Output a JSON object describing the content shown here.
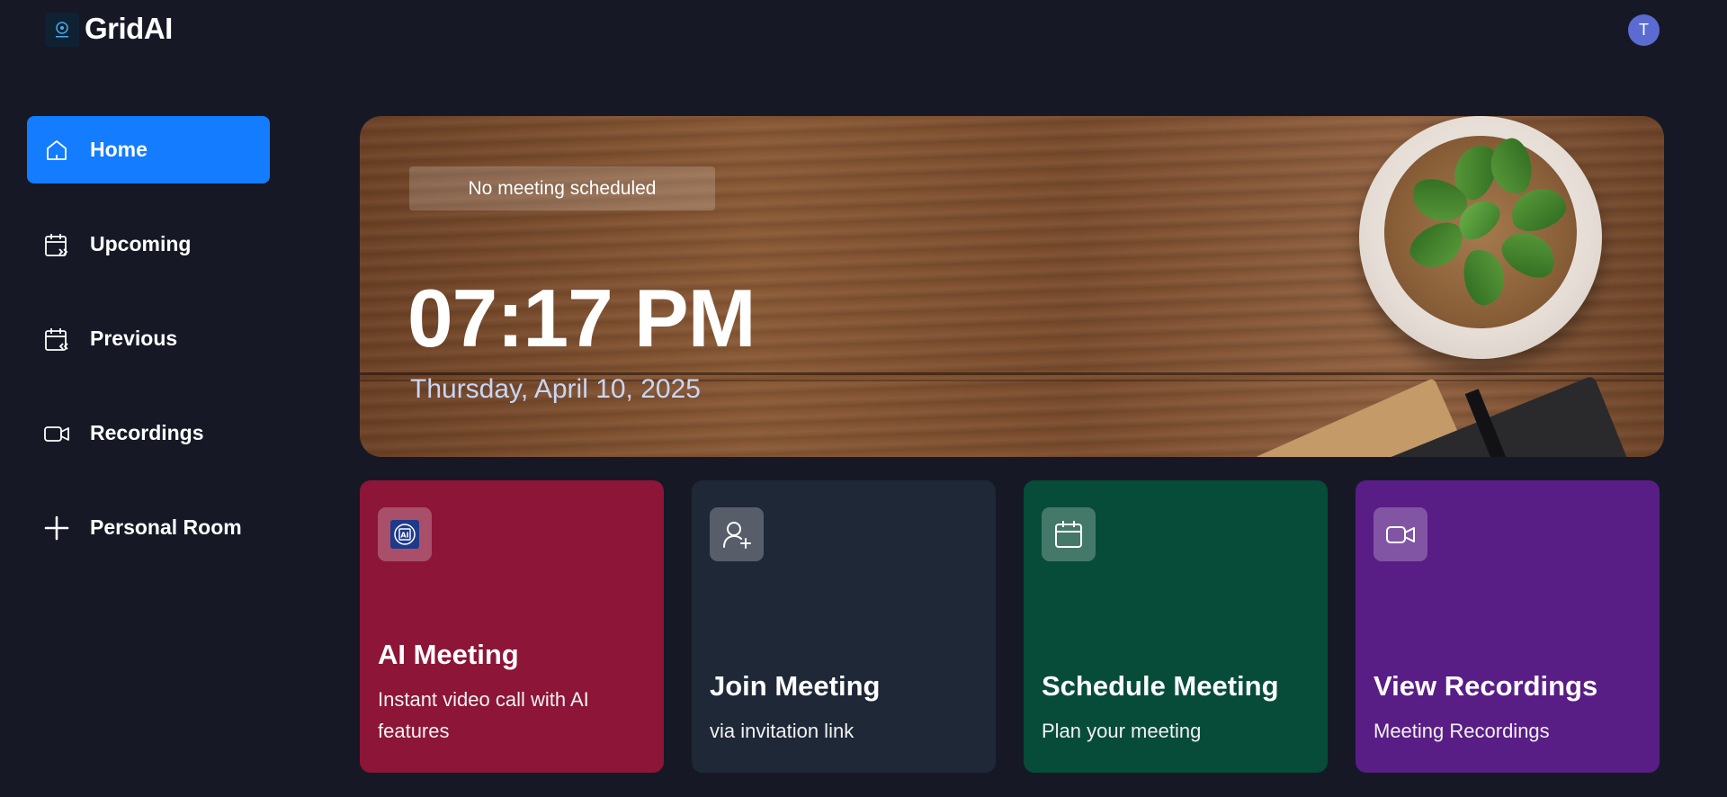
{
  "app": {
    "brand": "GridAI",
    "user_initial": "T"
  },
  "sidebar": {
    "items": [
      {
        "label": "Home",
        "icon": "home-icon",
        "active": true
      },
      {
        "label": "Upcoming",
        "icon": "calendar-forward-icon",
        "active": false
      },
      {
        "label": "Previous",
        "icon": "calendar-back-icon",
        "active": false
      },
      {
        "label": "Recordings",
        "icon": "video-icon",
        "active": false
      },
      {
        "label": "Personal Room",
        "icon": "plus-icon",
        "active": false
      }
    ]
  },
  "hero": {
    "badge": "No meeting scheduled",
    "time": "07:17 PM",
    "date": "Thursday, April 10, 2025"
  },
  "cards": [
    {
      "title": "AI Meeting",
      "subtitle": "Instant video call with AI features",
      "icon": "ai-chip-icon",
      "color": "#8c1538"
    },
    {
      "title": "Join Meeting",
      "subtitle": "via invitation link",
      "icon": "user-plus-icon",
      "color": "#1f2837"
    },
    {
      "title": "Schedule Meeting",
      "subtitle": "Plan your meeting",
      "icon": "calendar-icon",
      "color": "#064c39"
    },
    {
      "title": "View Recordings",
      "subtitle": "Meeting Recordings",
      "icon": "video-icon",
      "color": "#591d86"
    }
  ],
  "colors": {
    "background": "#161925",
    "accent": "#137cff",
    "avatar": "#5b6bd1"
  }
}
